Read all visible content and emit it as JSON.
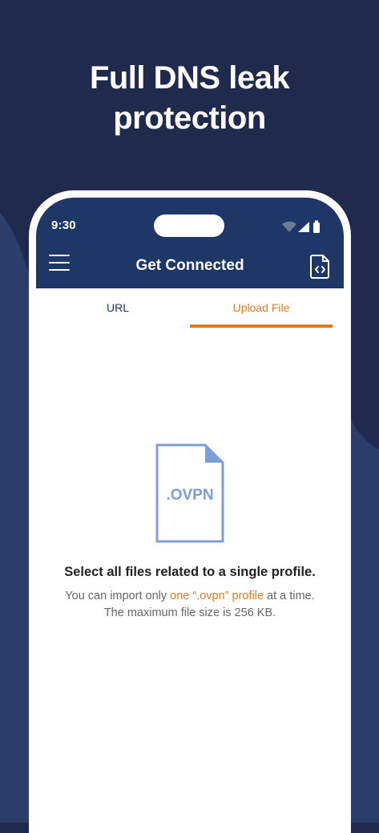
{
  "headline": {
    "line1": "Full DNS leak",
    "line2": "protection"
  },
  "status_bar": {
    "time": "9:30",
    "icons": [
      "wifi-icon",
      "cellular-signal-icon",
      "battery-icon"
    ]
  },
  "header": {
    "title": "Get Connected",
    "left_icon": "menu-icon",
    "right_icon": "file-code-icon"
  },
  "tabs": [
    {
      "label": "URL",
      "active": false
    },
    {
      "label": "Upload File",
      "active": true
    }
  ],
  "upload": {
    "file_label": ".OVPN",
    "main_message": "Select all files related to a single profile.",
    "sub_before": "You can import only ",
    "sub_highlight": "one “.ovpn” profile",
    "sub_after": " at a time.",
    "sub_line2": "The maximum file size is 256 KB."
  },
  "colors": {
    "background": "#1f2a4d",
    "header": "#1e3766",
    "accent": "#e07a25",
    "file_icon": "#7b9fd6"
  }
}
